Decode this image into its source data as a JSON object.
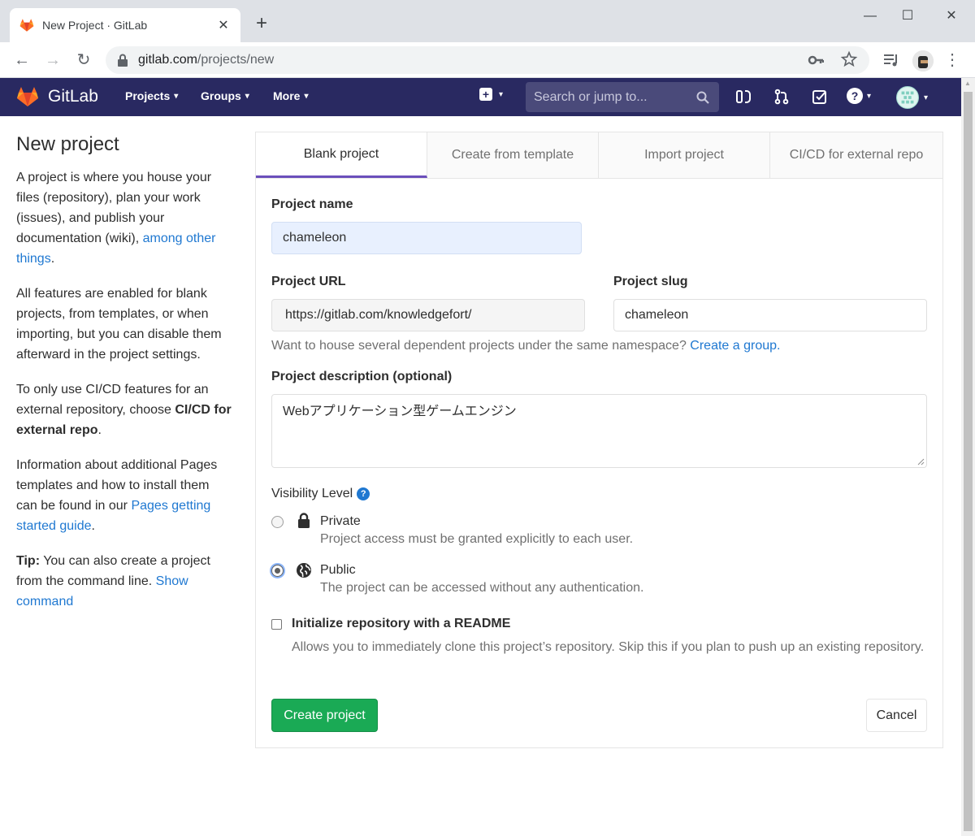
{
  "browser": {
    "tab_title": "New Project · GitLab",
    "url_host": "gitlab.com",
    "url_path": "/projects/new"
  },
  "gitlab_header": {
    "brand": "GitLab",
    "nav": [
      "Projects",
      "Groups",
      "More"
    ],
    "search_placeholder": "Search or jump to...",
    "colors": {
      "header_bg": "#292961",
      "accent": "#6b4fbb",
      "link": "#1f78d1",
      "success": "#1aaa55"
    }
  },
  "sidebar": {
    "title": "New project",
    "p1_text": "A project is where you house your files (repository), plan your work (issues), and publish your documentation (wiki),",
    "p1_link": "among other things",
    "p1_end": ".",
    "p2": "All features are enabled for blank projects, from templates, or when importing, but you can disable them afterward in the project settings.",
    "p3_text": "To only use CI/CD features for an external repository, choose",
    "p3_bold": "CI/CD for external repo",
    "p3_end": ".",
    "p4_text": "Information about additional Pages templates and how to install them can be found in our",
    "p4_link": "Pages getting started guide",
    "p4_end": ".",
    "tip_label": "Tip:",
    "tip_text": "You can also create a project from the command line.",
    "tip_link": "Show command"
  },
  "tabs": [
    "Blank project",
    "Create from template",
    "Import project",
    "CI/CD for external repo"
  ],
  "form": {
    "project_name_label": "Project name",
    "project_name_value": "chameleon",
    "project_url_label": "Project URL",
    "project_url_value": "https://gitlab.com/knowledgefort/",
    "project_slug_label": "Project slug",
    "project_slug_value": "chameleon",
    "namespace_hint": "Want to house several dependent projects under the same namespace?",
    "namespace_link": "Create a group.",
    "description_label": "Project description (optional)",
    "description_value": "Webアプリケーション型ゲームエンジン",
    "visibility_label": "Visibility Level",
    "visibility_options": [
      {
        "title": "Private",
        "desc": "Project access must be granted explicitly to each user.",
        "icon": "lock-icon",
        "checked": false
      },
      {
        "title": "Public",
        "desc": "The project can be accessed without any authentication.",
        "icon": "globe-icon",
        "checked": true
      }
    ],
    "readme_title": "Initialize repository with a README",
    "readme_desc": "Allows you to immediately clone this project’s repository. Skip this if you plan to push up an existing repository.",
    "readme_checked": false,
    "create_button": "Create project",
    "cancel_button": "Cancel"
  }
}
